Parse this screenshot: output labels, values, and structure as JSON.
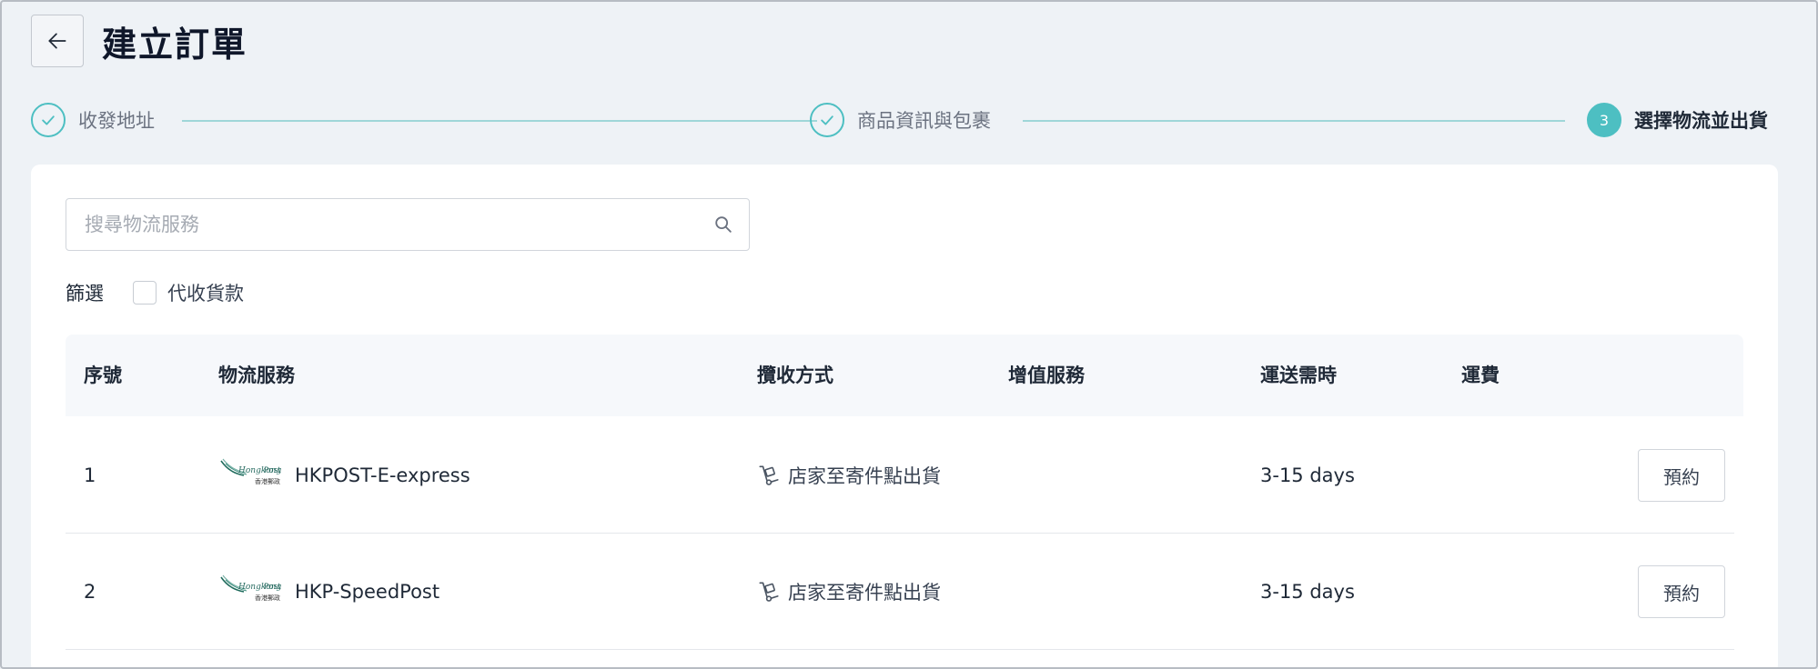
{
  "header": {
    "back_icon": "arrow-left-icon",
    "title": "建立訂單"
  },
  "stepper": {
    "steps": [
      {
        "label": "收發地址",
        "status": "done",
        "icon": "check-icon"
      },
      {
        "label": "商品資訊與包裹",
        "status": "done",
        "icon": "check-icon"
      },
      {
        "label": "選擇物流並出貨",
        "status": "active",
        "number": "3"
      }
    ]
  },
  "search": {
    "placeholder": "搜尋物流服務",
    "value": "",
    "icon": "search-icon"
  },
  "filter": {
    "label": "篩選",
    "options": [
      {
        "label": "代收貨款",
        "checked": false
      }
    ]
  },
  "table": {
    "columns": [
      "序號",
      "物流服務",
      "攬收方式",
      "增值服務",
      "運送需時",
      "運費"
    ],
    "rows": [
      {
        "index": "1",
        "logo": "hongkong-post-logo",
        "service": "HKPOST-E-express",
        "method_icon": "hand-truck-icon",
        "method": "店家至寄件點出貨",
        "value_added": "",
        "duration": "3-15 days",
        "fee": "",
        "action": "預約"
      },
      {
        "index": "2",
        "logo": "hongkong-post-logo",
        "service": "HKP-SpeedPost",
        "method_icon": "hand-truck-icon",
        "method": "店家至寄件點出貨",
        "value_added": "",
        "duration": "3-15 days",
        "fee": "",
        "action": "預約"
      }
    ]
  },
  "colors": {
    "accent": "#4dbfc2",
    "background": "#eef2f6",
    "card": "#ffffff",
    "table_header": "#f6f8fb"
  }
}
